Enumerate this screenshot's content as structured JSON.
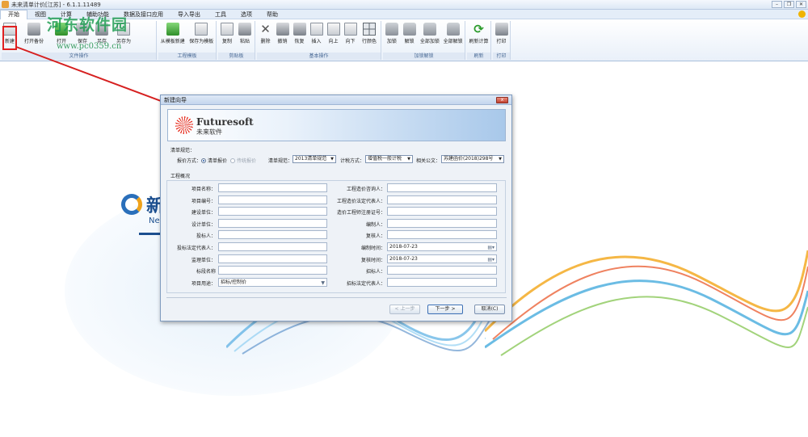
{
  "window": {
    "title": "未来清单计价[江苏] - 6.1.1.11489"
  },
  "menu": [
    "开始",
    "视图",
    "计算",
    "辅助功能",
    "数据及接口应用",
    "导入导出",
    "工具",
    "选项",
    "帮助"
  ],
  "ribbon": {
    "groups": [
      {
        "caption": "文件操作",
        "buttons": [
          "新建",
          "打开备份",
          "打开",
          "保存",
          "另存",
          "另存为"
        ]
      },
      {
        "caption": "工程模板",
        "buttons": [
          "从模板新建",
          "保存为模板"
        ]
      },
      {
        "caption": "剪贴板",
        "buttons": [
          "复制",
          "粘贴"
        ]
      },
      {
        "caption": "基本操作",
        "buttons": [
          "删除",
          "撤销",
          "恢复",
          "插入",
          "向上",
          "向下",
          "行颜色"
        ]
      },
      {
        "caption": "加锁解锁",
        "buttons": [
          "加锁",
          "解锁",
          "全部加锁",
          "全部解锁"
        ]
      },
      {
        "caption": "刷新",
        "buttons": [
          "刷新计算"
        ]
      },
      {
        "caption": "打印",
        "buttons": [
          "打印"
        ]
      }
    ]
  },
  "watermark": {
    "text": "河东软件园",
    "url": "www.pc0359.cn"
  },
  "background": {
    "logo_text": "新",
    "logo_sub": "Ne"
  },
  "dialog": {
    "title": "新建向导",
    "close": "x",
    "banner": {
      "brand": "Futuresoft",
      "sub": "未来软件"
    },
    "spec_section": "清单规范：",
    "pricing_label": "报价方式：",
    "pricing_opt1": "清单报价",
    "pricing_opt2": "传统报价",
    "spec_label": "清单规范：",
    "spec_value": "2013清单规范",
    "tax_label": "计税方式：",
    "tax_value": "增值税一般计税",
    "doc_label": "相关公文：",
    "doc_value": "苏建函价(2018)298号",
    "overview_section": "工程概况",
    "left_fields": [
      {
        "label": "项目名称：",
        "value": ""
      },
      {
        "label": "项目编号：",
        "value": ""
      },
      {
        "label": "建设单位：",
        "value": ""
      },
      {
        "label": "设计单位：",
        "value": ""
      },
      {
        "label": "投标人：",
        "value": ""
      },
      {
        "label": "投标法定代表人：",
        "value": ""
      },
      {
        "label": "监理单位：",
        "value": ""
      },
      {
        "label": "标段名称",
        "value": ""
      },
      {
        "label": "项目用途：",
        "value": "招标/控制价"
      }
    ],
    "right_fields": [
      {
        "label": "工程造价咨询人：",
        "value": ""
      },
      {
        "label": "工程造价法定代表人：",
        "value": ""
      },
      {
        "label": "造价工程师注册证号：",
        "value": ""
      },
      {
        "label": "编制人：",
        "value": ""
      },
      {
        "label": "复核人：",
        "value": ""
      },
      {
        "label": "编制时间：",
        "value": "2018-07-23"
      },
      {
        "label": "复核时间：",
        "value": "2018-07-23"
      },
      {
        "label": "招标人：",
        "value": ""
      },
      {
        "label": "招标法定代表人：",
        "value": ""
      }
    ],
    "btn_prev": "< 上一步",
    "btn_next": "下一步 >",
    "btn_cancel": "取消(C)"
  }
}
